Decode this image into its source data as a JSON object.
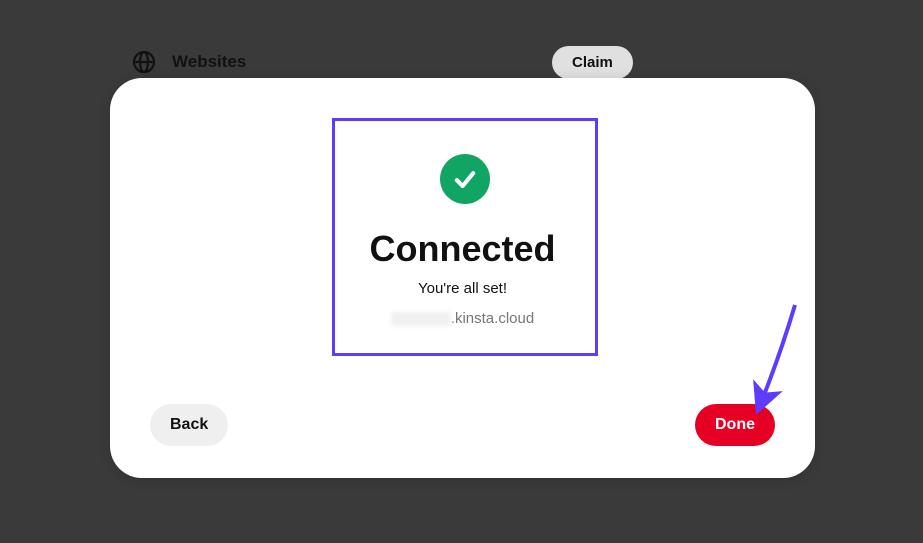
{
  "header": {
    "section_label": "Websites",
    "claim_label": "Claim"
  },
  "modal": {
    "title": "Connected",
    "subtitle": "You're all set!",
    "domain_suffix": ".kinsta.cloud",
    "back_label": "Back",
    "done_label": "Done"
  },
  "colors": {
    "accent_highlight": "#5d3bff",
    "success_green": "#11a564",
    "primary_red": "#e60023"
  }
}
